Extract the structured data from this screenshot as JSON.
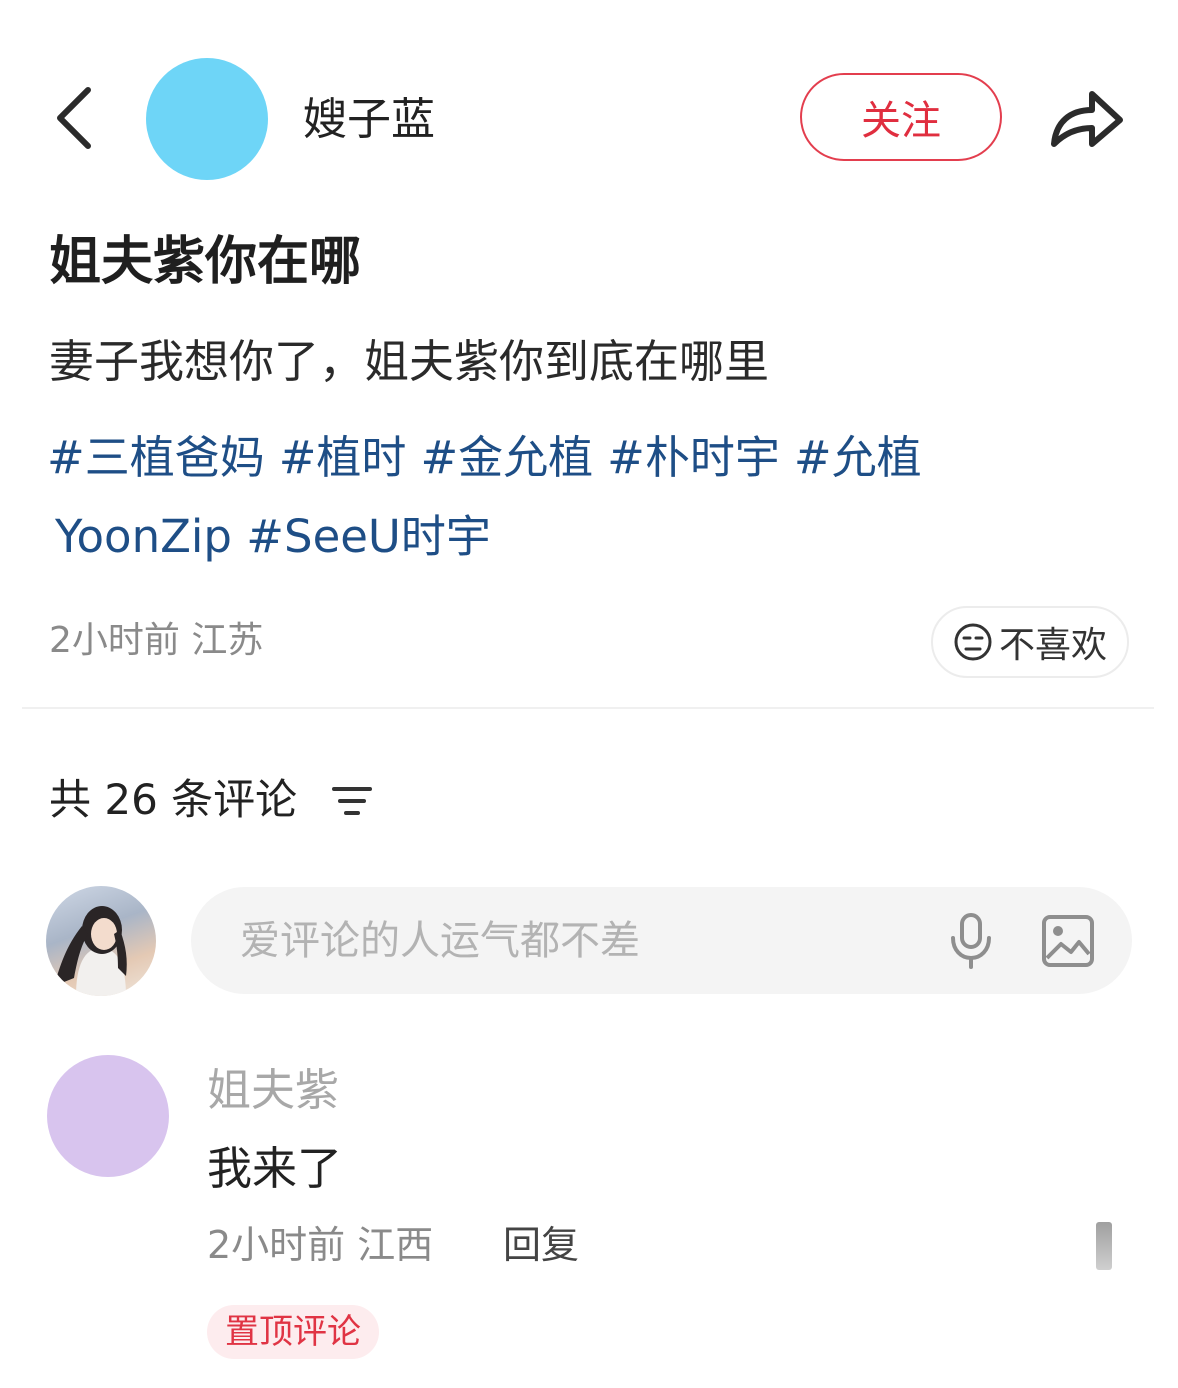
{
  "header": {
    "author_name": "嫂子蓝",
    "follow_label": "关注",
    "avatar_color": "#6ed5f7",
    "accent_color": "#e02e3f"
  },
  "post": {
    "title": "姐夫紫你在哪",
    "body": "妻子我想你了，姐夫紫你到底在哪里",
    "tags": [
      "#三植爸妈",
      "#植时",
      "#金允植",
      "#朴时宇",
      "#允植"
    ],
    "tags_line2": "YoonZip #SeeU时宇",
    "meta": "2小时前 江苏",
    "dislike_label": "不喜欢"
  },
  "comments": {
    "count_label": "共 26 条评论",
    "input_placeholder": "爱评论的人运气都不差",
    "items": [
      {
        "user": "姐夫紫",
        "text": "我来了",
        "meta": "2小时前 江西",
        "reply_label": "回复",
        "badge": "置顶评论",
        "avatar_color": "#d8c4ee"
      }
    ]
  },
  "icons": {
    "back": "chevron-left-icon",
    "share": "share-arrow-icon",
    "dislike": "neutral-face-icon",
    "filter": "filter-lines-icon",
    "mic": "microphone-icon",
    "image": "image-icon"
  }
}
